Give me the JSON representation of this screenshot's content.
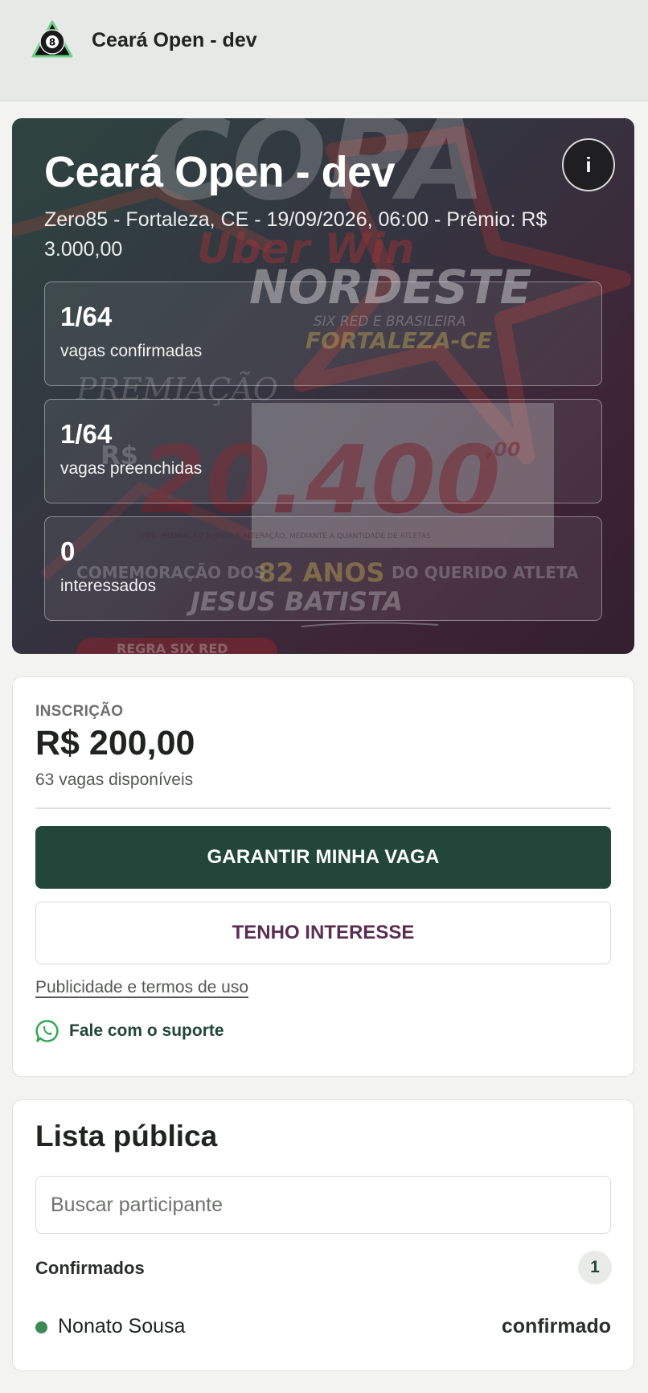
{
  "header": {
    "app_title": "Ceará Open - dev",
    "logo_icon": "billiard-8-ball-icon"
  },
  "hero": {
    "title": "Ceará Open - dev",
    "subtitle": "Zero85 - Fortaleza, CE - 19/09/2026, 06:00 - Prêmio: R$ 3.000,00",
    "info_label": "i",
    "stats": [
      {
        "value": "1/64",
        "label": "vagas confirmadas"
      },
      {
        "value": "1/64",
        "label": "vagas preenchidas"
      },
      {
        "value": "0",
        "label": "interessados"
      }
    ],
    "poster": {
      "top": "COPA",
      "brand": "Uber Win",
      "region": "NORDESTE",
      "modes": "SIX RED E BRASILEIRA",
      "city": "FORTALEZA-CE",
      "prize_heading": "PREMIAÇÃO",
      "currency": "R$",
      "amount": "20.400",
      "cents": ",00",
      "note": "OBS: PREMIAÇÃO SUJEITA A ALTERAÇÃO, MEDIANTE A QUANTIDADE DE ATLETAS",
      "tribute_a": "COMEMORAÇÃO DOS",
      "tribute_b": "82 ANOS",
      "tribute_c": "DO QUERIDO ATLETA",
      "honoree": "JESUS BATISTA",
      "rule": "REGRA SIX RED"
    }
  },
  "registration": {
    "label": "INSCRIÇÃO",
    "price": "R$ 200,00",
    "availability": "63 vagas disponíveis",
    "primary_button": "GARANTIR MINHA VAGA",
    "secondary_button": "TENHO INTERESSE",
    "terms_link": "Publicidade e termos de uso",
    "support_label": "Fale com o suporte",
    "support_icon": "whatsapp-icon"
  },
  "public_list": {
    "title": "Lista pública",
    "search_placeholder": "Buscar participante",
    "section_label": "Confirmados",
    "count": "1",
    "participants": [
      {
        "name": "Nonato Sousa",
        "status": "confirmado"
      }
    ]
  },
  "colors": {
    "brand_green": "#22473a",
    "accent_purple": "#5a2d52",
    "status_dot": "#3d8a55"
  }
}
